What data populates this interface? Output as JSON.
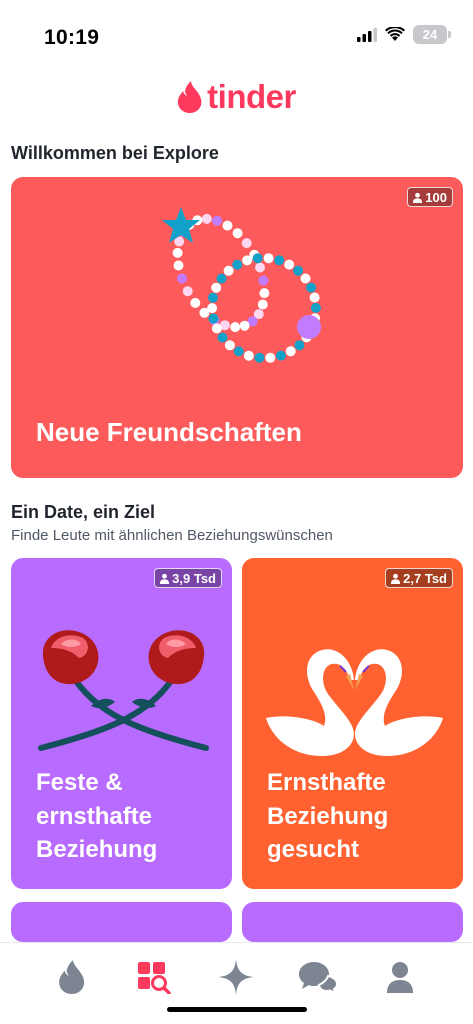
{
  "status_bar": {
    "time": "10:19",
    "battery": "24",
    "icons": [
      "cellular-signal-icon",
      "wifi-icon",
      "battery-icon"
    ]
  },
  "header": {
    "logo_text": "tinder",
    "logo_icon": "flame-icon",
    "brand_color": "#fd3a5e"
  },
  "welcome": {
    "title": "Willkommen bei Explore",
    "card": {
      "title": "Neue Freundschaften",
      "badge": "100",
      "color": "#fd5b5b"
    }
  },
  "date_section": {
    "title": "Ein Date, ein Ziel",
    "subtitle": "Finde Leute mit ähnlichen Beziehungswünschen",
    "cards": [
      {
        "title": "Feste & ernsthafte Beziehung",
        "badge": "3,9 Tsd",
        "color": "#b86bff"
      },
      {
        "title": "Ernsthafte Beziehung gesucht",
        "badge": "2,7 Tsd",
        "color": "#ff6230"
      }
    ]
  },
  "bottom_nav": {
    "items": [
      {
        "name": "home",
        "icon": "flame-icon",
        "active": false
      },
      {
        "name": "explore",
        "icon": "explore-grid-search-icon",
        "active": true
      },
      {
        "name": "sparks",
        "icon": "sparkle-icon",
        "active": false
      },
      {
        "name": "chat",
        "icon": "chat-bubbles-icon",
        "active": false
      },
      {
        "name": "profile",
        "icon": "person-icon",
        "active": false
      }
    ],
    "active_color": "#fd3a5e",
    "inactive_color": "#7c8591"
  }
}
